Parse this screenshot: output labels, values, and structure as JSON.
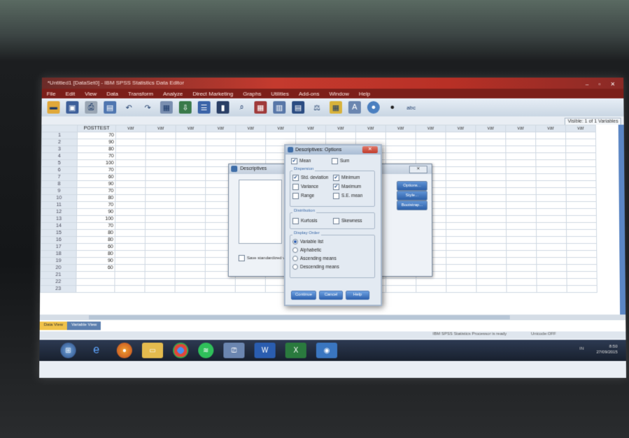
{
  "window": {
    "title": "*Untitled1 [DataSet0] - IBM SPSS Statistics Data Editor",
    "controls": "– ▫ ✕"
  },
  "menu": [
    "File",
    "Edit",
    "View",
    "Data",
    "Transform",
    "Analyze",
    "Direct Marketing",
    "Graphs",
    "Utilities",
    "Add-ons",
    "Window",
    "Help"
  ],
  "toolbar_icons": [
    "open-icon",
    "save-icon",
    "print-icon",
    "dialog-recall-icon",
    "undo-icon",
    "redo-icon",
    "goto-case-icon",
    "goto-variable-icon",
    "variables-icon",
    "run-descriptives-icon",
    "find-icon",
    "insert-cases-icon",
    "insert-variable-icon",
    "split-file-icon",
    "weight-cases-icon",
    "select-cases-icon",
    "value-labels-icon",
    "use-sets-icon",
    "show-all-icon",
    "spelling-icon"
  ],
  "visible_vars": "Visible: 1 of 1 Variables",
  "columns": [
    "POSTTEST",
    "var",
    "var",
    "var",
    "var",
    "var",
    "var",
    "var",
    "var",
    "var",
    "var",
    "var",
    "var",
    "var",
    "var",
    "var",
    "var"
  ],
  "rows": [
    {
      "n": "1",
      "v": "70"
    },
    {
      "n": "2",
      "v": "90"
    },
    {
      "n": "3",
      "v": "80"
    },
    {
      "n": "4",
      "v": "70"
    },
    {
      "n": "5",
      "v": "100"
    },
    {
      "n": "6",
      "v": "70"
    },
    {
      "n": "7",
      "v": "60"
    },
    {
      "n": "8",
      "v": "90"
    },
    {
      "n": "9",
      "v": "70"
    },
    {
      "n": "10",
      "v": "80"
    },
    {
      "n": "11",
      "v": "70"
    },
    {
      "n": "12",
      "v": "90"
    },
    {
      "n": "13",
      "v": "100"
    },
    {
      "n": "14",
      "v": "70"
    },
    {
      "n": "15",
      "v": "80"
    },
    {
      "n": "16",
      "v": "80"
    },
    {
      "n": "17",
      "v": "60"
    },
    {
      "n": "18",
      "v": "80"
    },
    {
      "n": "19",
      "v": "90"
    },
    {
      "n": "20",
      "v": "60"
    },
    {
      "n": "21",
      "v": ""
    },
    {
      "n": "22",
      "v": ""
    },
    {
      "n": "23",
      "v": ""
    }
  ],
  "tabs": {
    "data_view": "Data View",
    "variable_view": "Variable View"
  },
  "status": {
    "processor": "IBM SPSS Statistics Processor is ready",
    "unicode": "Unicode:OFF"
  },
  "descriptives": {
    "title": "Descriptives",
    "close": "✕",
    "buttons": {
      "options": "Options...",
      "style": "Style...",
      "bootstrap": "Bootstrap..."
    },
    "save_label": "Save standardized values as variables"
  },
  "options": {
    "title": "Descriptives: Options",
    "close": "✕",
    "mean": "Mean",
    "sum": "Sum",
    "dispersion_label": "Dispersion",
    "std": "Std. deviation",
    "minimum": "Minimum",
    "variance": "Variance",
    "maximum": "Maximum",
    "range": "Range",
    "se_mean": "S.E. mean",
    "distribution_label": "Distribution",
    "kurtosis": "Kurtosis",
    "skewness": "Skewness",
    "display_label": "Display Order",
    "variable_list": "Variable list",
    "alphabetic": "Alphabetic",
    "ascending": "Ascending means",
    "descending": "Descending means",
    "continue": "Continue",
    "cancel": "Cancel",
    "help": "Help"
  },
  "taskbar_icons": [
    "start-icon",
    "ie-icon",
    "firefox-icon",
    "explorer-icon",
    "chrome-icon",
    "spotify-icon",
    "network-icon",
    "word-icon",
    "excel-icon",
    "spss-icon"
  ],
  "tray": "IN",
  "clock": {
    "time": "8:50",
    "date": "27/09/2015"
  }
}
